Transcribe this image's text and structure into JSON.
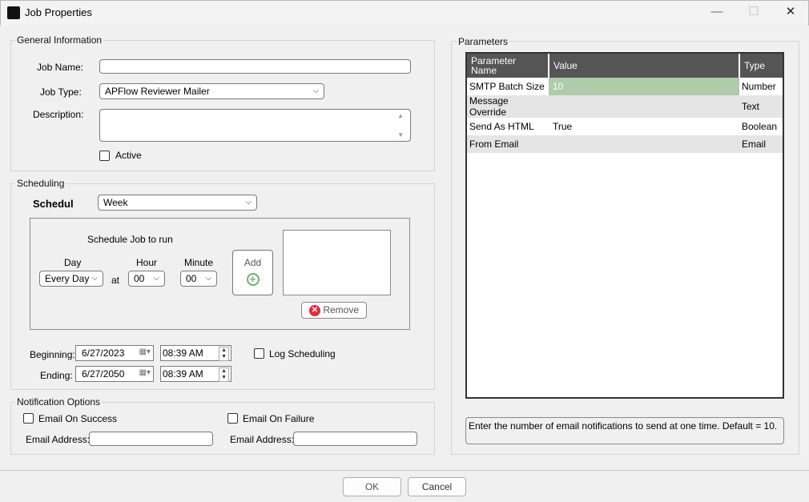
{
  "window": {
    "title": "Job Properties",
    "minimize": "—",
    "maximize": "☐",
    "close": "✕"
  },
  "general": {
    "legend": "General Information",
    "job_name_label": "Job Name:",
    "job_name_value": "",
    "job_type_label": "Job Type:",
    "job_type_value": "APFlow Reviewer Mailer",
    "description_label": "Description:",
    "description_value": "",
    "active_label": "Active",
    "active_checked": false
  },
  "scheduling": {
    "legend": "Scheduling",
    "schedule_label": "Schedule",
    "schedule_value": "Week",
    "run_title": "Schedule Job to run",
    "day_label": "Day",
    "day_value": "Every Day",
    "at_label": "at",
    "hour_label": "Hour",
    "hour_value": "00",
    "minute_label": "Minute",
    "minute_value": "00",
    "add_label": "Add",
    "remove_label": "Remove",
    "beginning_label": "Beginning:",
    "beginning_date": "6/27/2023",
    "beginning_time": "08:39 AM",
    "ending_label": "Ending:",
    "ending_date": "6/27/2050",
    "ending_time": "08:39 AM",
    "log_label": "Log Scheduling",
    "log_checked": false
  },
  "notification": {
    "legend": "Notification Options",
    "success_label": "Email On Success",
    "failure_label": "Email On Failure",
    "email_label_1": "Email Address:",
    "email_label_2": "Email Address:",
    "email_value_1": "",
    "email_value_2": ""
  },
  "parameters": {
    "legend": "Parameters",
    "columns": [
      "Parameter Name",
      "Value",
      "Type"
    ],
    "rows": [
      {
        "name": "SMTP Batch Size",
        "value": "10",
        "type": "Number"
      },
      {
        "name": "Message Override",
        "value": "",
        "type": "Text"
      },
      {
        "name": "Send As HTML",
        "value": "True",
        "type": "Boolean"
      },
      {
        "name": "From Email",
        "value": "",
        "type": "Email"
      }
    ],
    "selected_color": "#afcbaa",
    "help_text": "Enter the number of email notifications to send at one time. Default = 10."
  },
  "footer": {
    "ok": "OK",
    "cancel": "Cancel"
  }
}
